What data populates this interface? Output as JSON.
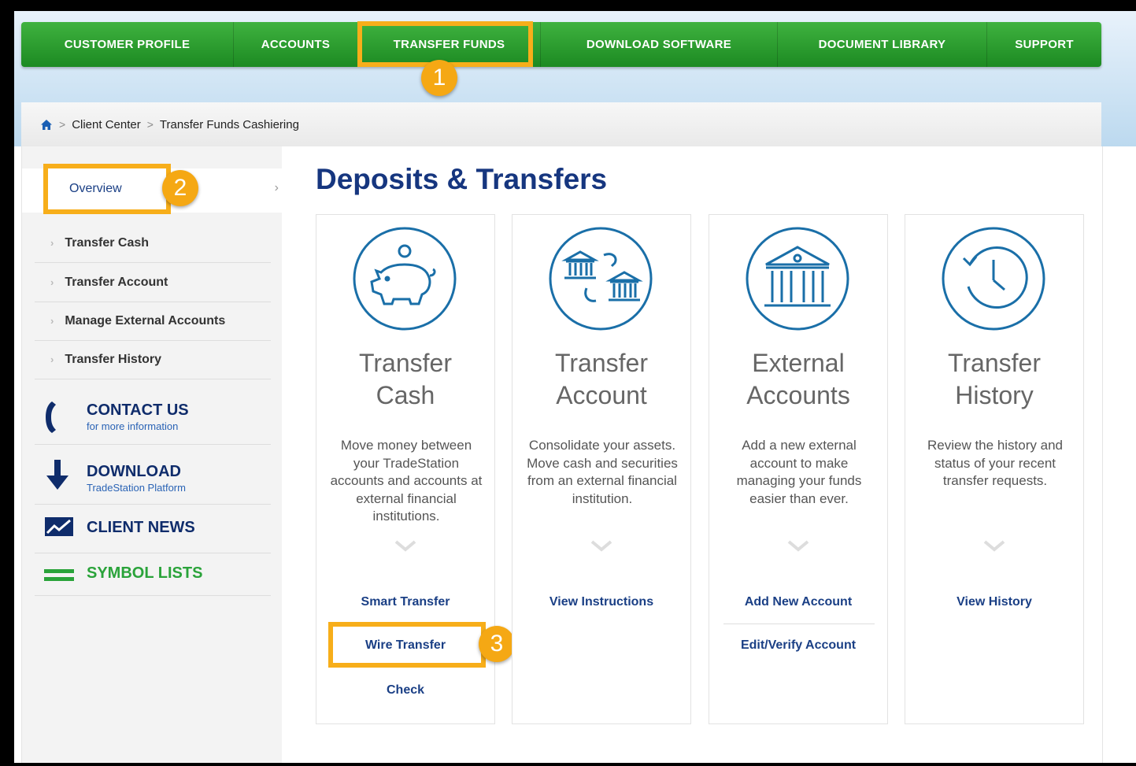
{
  "nav": {
    "items": [
      {
        "label": "CUSTOMER PROFILE"
      },
      {
        "label": "ACCOUNTS"
      },
      {
        "label": "TRANSFER FUNDS"
      },
      {
        "label": "DOWNLOAD SOFTWARE"
      },
      {
        "label": "DOCUMENT LIBRARY"
      },
      {
        "label": "SUPPORT"
      }
    ]
  },
  "badges": {
    "one": "1",
    "two": "2",
    "three": "3"
  },
  "breadcrumb": {
    "home_icon": "home-icon",
    "items": [
      "Client Center",
      "Transfer Funds Cashiering"
    ]
  },
  "sidebar": {
    "overview": "Overview",
    "items": [
      "Transfer Cash",
      "Transfer Account",
      "Manage External Accounts",
      "Transfer History"
    ],
    "contact": {
      "title": "CONTACT US",
      "sub": "for more information"
    },
    "download": {
      "title": "DOWNLOAD",
      "sub": "TradeStation Platform"
    },
    "news": {
      "title": "CLIENT NEWS"
    },
    "symbols": {
      "title": "SYMBOL LISTS"
    }
  },
  "main": {
    "title": "Deposits & Transfers",
    "cards": [
      {
        "icon": "piggy-bank-icon",
        "title1": "Transfer",
        "title2": "Cash",
        "desc": "Move money between your TradeStation accounts and accounts at external financial institutions.",
        "links": [
          "Smart Transfer",
          "Wire Transfer",
          "Check"
        ]
      },
      {
        "icon": "bank-transfer-icon",
        "title1": "Transfer",
        "title2": "Account",
        "desc": "Consolidate your assets. Move cash and securities from an external financial institution.",
        "links": [
          "View Instructions"
        ]
      },
      {
        "icon": "bank-icon",
        "title1": "External",
        "title2": "Accounts",
        "desc": "Add a new external account to make managing your funds easier than ever.",
        "links": [
          "Add New Account",
          "Edit/Verify Account"
        ]
      },
      {
        "icon": "clock-history-icon",
        "title1": "Transfer",
        "title2": "History",
        "desc": "Review the history and status of your recent transfer requests.",
        "links": [
          "View History"
        ]
      }
    ]
  },
  "colors": {
    "nav_green": "#24962b",
    "highlight": "#f7ae1a",
    "title_blue": "#16367f",
    "icon_blue": "#1a6fa8"
  }
}
